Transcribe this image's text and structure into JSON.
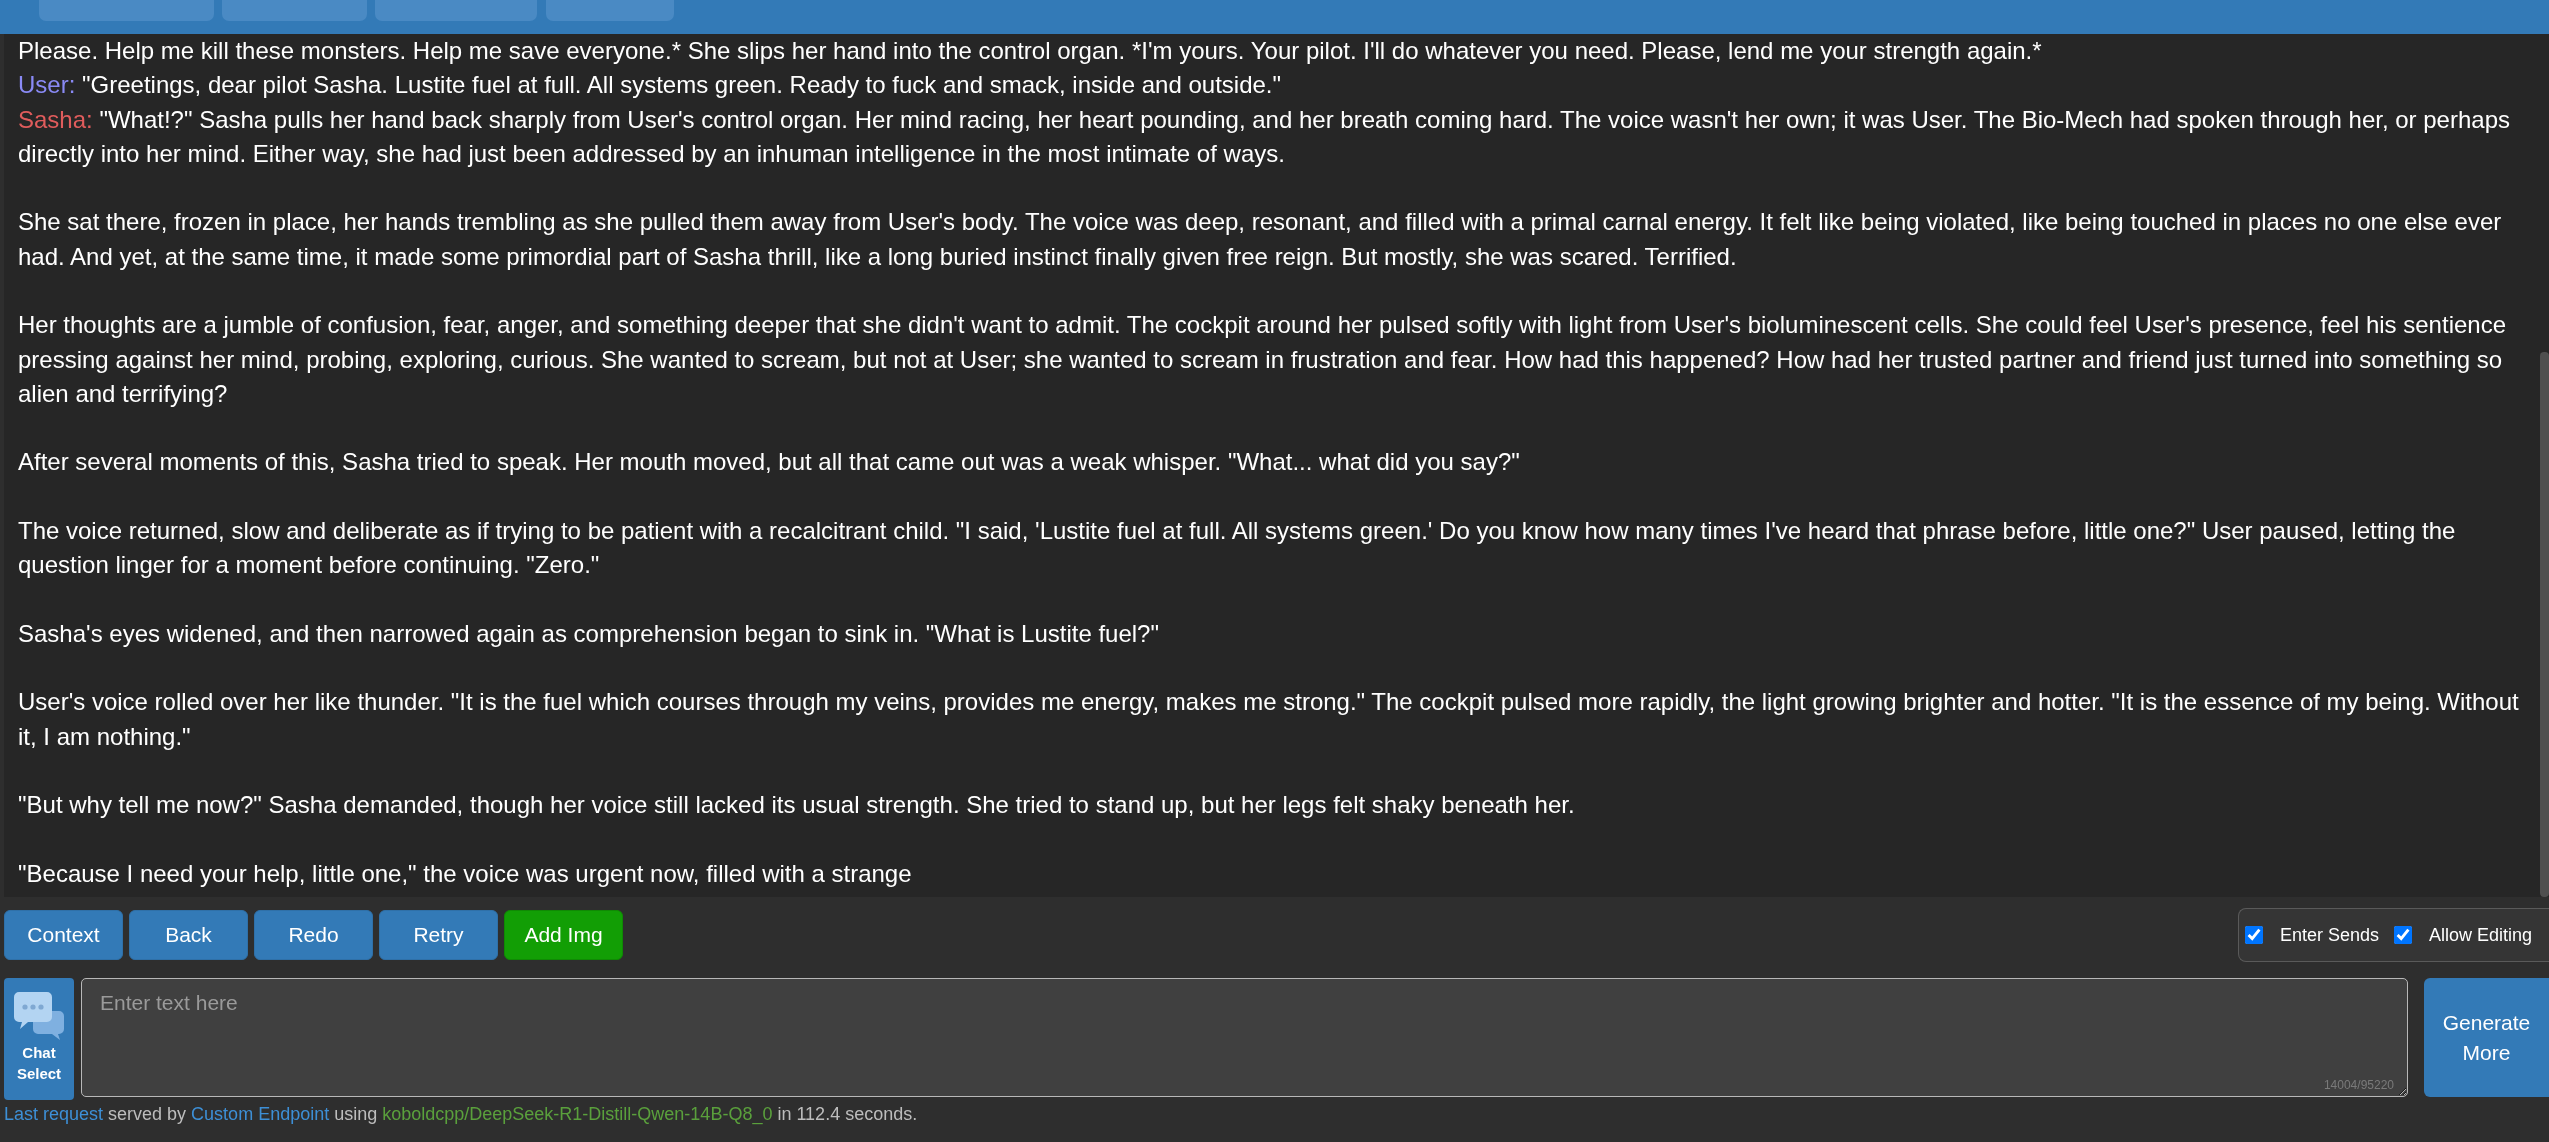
{
  "top_bar": {
    "buttons": [
      {
        "kind": "button"
      },
      {
        "kind": "button"
      },
      {
        "kind": "button"
      },
      {
        "kind": "button"
      }
    ]
  },
  "chat": {
    "messages": [
      {
        "kind": "continuation",
        "paragraphs": [
          "Please. Help me kill these monsters. Help me save everyone.* She slips her hand into the control organ. *I'm yours. Your pilot. I'll do whatever you need. Please, lend me your strength again.*"
        ]
      },
      {
        "kind": "turn",
        "speaker": "User:",
        "color": "#8a8af5",
        "paragraphs": [
          "\"Greetings, dear pilot Sasha. Lustite fuel at full. All systems green. Ready to fuck and smack, inside and outside.\""
        ]
      },
      {
        "kind": "turn",
        "speaker": "Sasha:",
        "color": "#e05c5c",
        "paragraphs": [
          "\"What!?\" Sasha pulls her hand back sharply from User's control organ. Her mind racing, her heart pounding, and her breath coming hard. The voice wasn't her own; it was User. The Bio-Mech had spoken through her, or perhaps directly into her mind. Either way, she had just been addressed by an inhuman intelligence in the most intimate of ways.",
          "She sat there, frozen in place, her hands trembling as she pulled them away from User's body. The voice was deep, resonant, and filled with a primal carnal energy. It felt like being violated, like being touched in places no one else ever had. And yet, at the same time, it made some primordial part of Sasha thrill, like a long buried instinct finally given free reign. But mostly, she was scared. Terrified.",
          "Her thoughts are a jumble of confusion, fear, anger, and something deeper that she didn't want to admit. The cockpit around her pulsed softly with light from User's bioluminescent cells. She could feel User's presence, feel his sentience pressing against her mind, probing, exploring, curious. She wanted to scream, but not at User; she wanted to scream in frustration and fear. How had this happened? How had her trusted partner and friend just turned into something so alien and terrifying?",
          "After several moments of this, Sasha tried to speak. Her mouth moved, but all that came out was a weak whisper. \"What... what did you say?\"",
          "The voice returned, slow and deliberate as if trying to be patient with a recalcitrant child. \"I said, 'Lustite fuel at full. All systems green.' Do you know how many times I've heard that phrase before, little one?\" User paused, letting the question linger for a moment before continuing. \"Zero.\"",
          "Sasha's eyes widened, and then narrowed again as comprehension began to sink in. \"What is Lustite fuel?\"",
          "User's voice rolled over her like thunder. \"It is the fuel which courses through my veins, provides me energy, makes me strong.\" The cockpit pulsed more rapidly, the light growing brighter and hotter. \"It is the essence of my being. Without it, I am nothing.\"",
          "\"But why tell me now?\" Sasha demanded, though her voice still lacked its usual strength. She tried to stand up, but her legs felt shaky beneath her.",
          "\"Because I need your help, little one,\" the voice was urgent now, filled with a strange"
        ]
      }
    ]
  },
  "action_buttons": [
    {
      "label": "Context",
      "kind": "primary"
    },
    {
      "label": "Back",
      "kind": "primary"
    },
    {
      "label": "Redo",
      "kind": "primary"
    },
    {
      "label": "Retry",
      "kind": "primary"
    },
    {
      "label": "Add Img",
      "kind": "success"
    }
  ],
  "options": [
    {
      "label": "Enter Sends",
      "checked": true
    },
    {
      "label": "Allow Editing",
      "checked": true
    }
  ],
  "chat_select": {
    "label": "Chat Select"
  },
  "input": {
    "placeholder": "Enter text here",
    "counter": "14004/95220"
  },
  "generate_button": {
    "label": "Generate More"
  },
  "status_line": {
    "parts": [
      {
        "kind": "link",
        "text": "Last request"
      },
      {
        "kind": "plain",
        "text": " served by "
      },
      {
        "kind": "link",
        "text": "Custom Endpoint"
      },
      {
        "kind": "plain",
        "text": " using "
      },
      {
        "kind": "model",
        "text": "koboldcpp/DeepSeek-R1-Distill-Qwen-14B-Q8_0"
      },
      {
        "kind": "plain",
        "text": " in 112.4 seconds."
      }
    ]
  }
}
